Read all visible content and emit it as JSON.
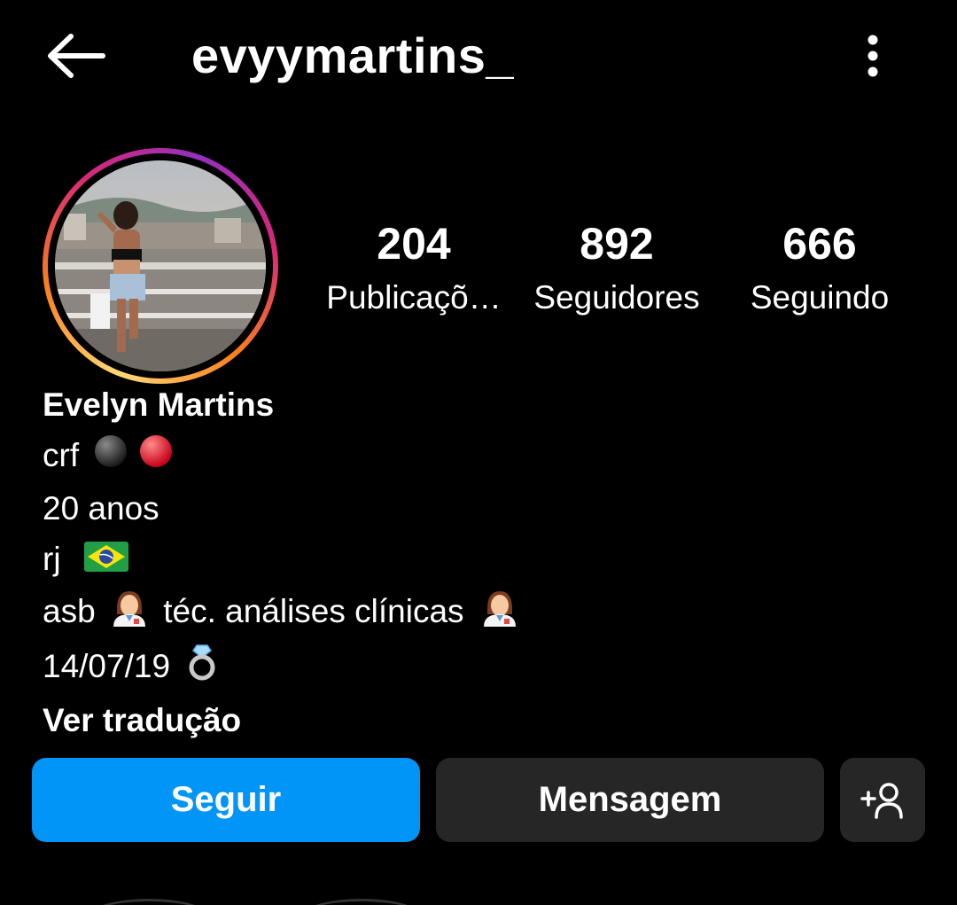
{
  "header": {
    "username": "evyymartins_",
    "back_icon": "arrow-left-icon",
    "more_icon": "more-vertical-icon"
  },
  "profile": {
    "avatar_icon": "profile-photo",
    "story_ring_colors": [
      "#feda75",
      "#fa7e1e",
      "#d62976",
      "#962fbf"
    ]
  },
  "stats": [
    {
      "value": "204",
      "label": "Publicaçõ…"
    },
    {
      "value": "892",
      "label": "Seguidores"
    },
    {
      "value": "666",
      "label": "Seguindo"
    }
  ],
  "bio": {
    "name": "Evelyn Martins",
    "line1": "crf",
    "line2": "20 anos",
    "line3": "rj",
    "line4a": "asb",
    "line4b": "téc. análises clínicas",
    "line5": "14/07/19",
    "translate": "Ver tradução"
  },
  "actions": {
    "follow": "Seguir",
    "message": "Mensagem",
    "suggest_icon": "add-person-icon"
  },
  "colors": {
    "background": "#000000",
    "accent": "#0095f6",
    "secondary_button": "#262626"
  }
}
